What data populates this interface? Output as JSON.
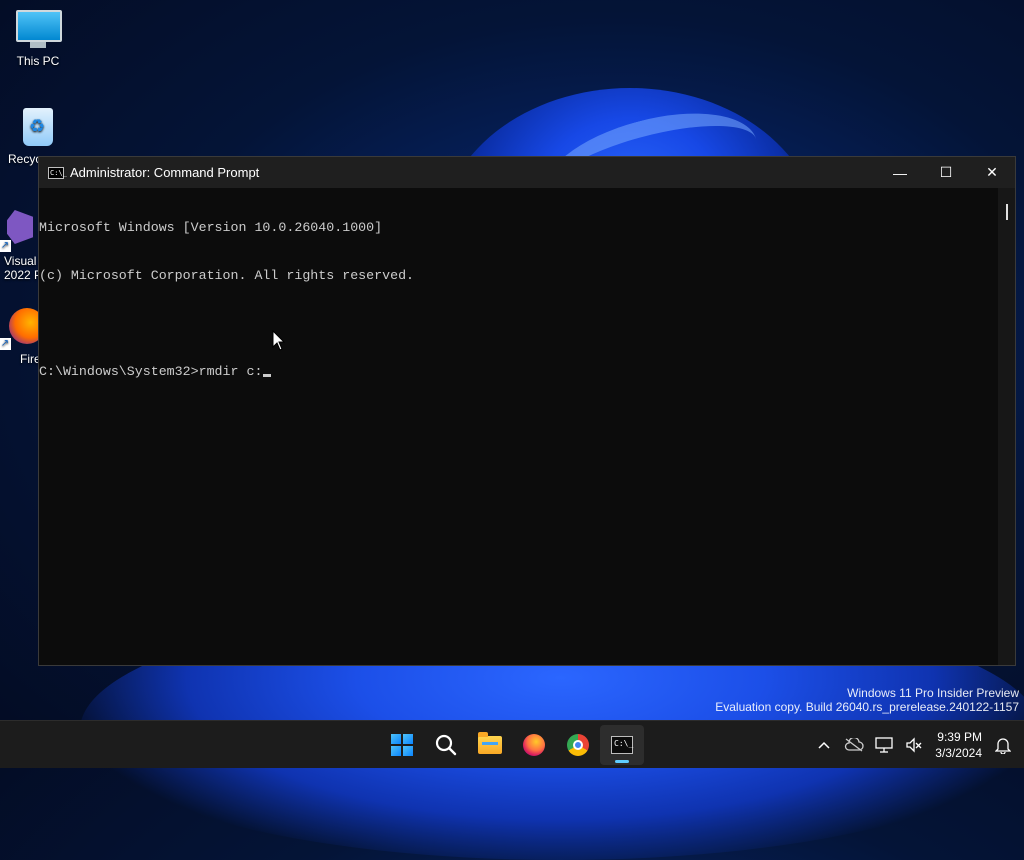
{
  "desktop": {
    "icons": [
      {
        "label": "This PC"
      },
      {
        "label": "Recyc"
      },
      {
        "label": "Visual\n2022 P"
      },
      {
        "label": "Fire"
      }
    ]
  },
  "window": {
    "title": "Administrator: Command Prompt",
    "title_icon_text": "C:\\_",
    "minimize_glyph": "—",
    "maximize_glyph": "☐",
    "close_glyph": "✕",
    "console_lines": [
      "Microsoft Windows [Version 10.0.26040.1000]",
      "(c) Microsoft Corporation. All rights reserved.",
      "",
      "C:\\Windows\\System32>rmdir c:"
    ]
  },
  "watermark": {
    "line1": "Windows 11 Pro Insider Preview",
    "line2": "Evaluation copy. Build 26040.rs_prerelease.240122-1157"
  },
  "taskbar": {
    "apps": [
      "start-icon",
      "search-icon",
      "file-explorer-icon",
      "firefox-icon",
      "chrome-icon",
      "command-prompt-icon"
    ],
    "cmd_icon_text": "C:\\_",
    "tray": {
      "chevron": "^",
      "clock_time": "9:39 PM",
      "clock_date": "3/3/2024"
    }
  },
  "colors": {
    "console_bg": "#0c0c0c",
    "console_fg": "#cccccc",
    "titlebar_bg": "#1f1f1f",
    "taskbar_bg": "#1c1c1c",
    "active_indicator": "#60cdff"
  }
}
